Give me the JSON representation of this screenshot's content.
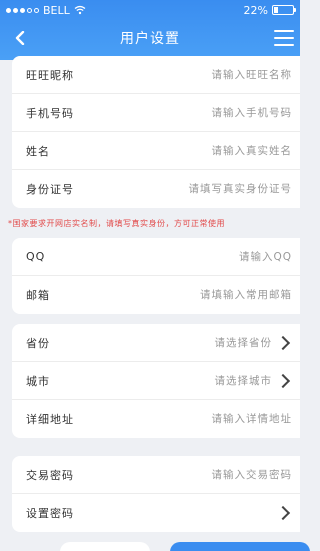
{
  "status_bar": {
    "carrier": "BELL",
    "battery": "22%",
    "battery_level": 0.22
  },
  "header": {
    "title": "用户设置"
  },
  "section1": [
    {
      "label": "旺旺昵称",
      "placeholder": "请输入旺旺名称"
    },
    {
      "label": "手机号码",
      "placeholder": "请输入手机号码"
    },
    {
      "label": "姓名",
      "placeholder": "请输入真实姓名"
    },
    {
      "label": "身份证号",
      "placeholder": "请填写真实身份证号"
    }
  ],
  "notice": "*国家要求开网店实名制，请填写真实身份，方可正常使用",
  "section2": [
    {
      "label": "QQ",
      "placeholder": "请输入QQ"
    },
    {
      "label": "邮箱",
      "placeholder": "请填输入常用邮箱"
    }
  ],
  "section3": [
    {
      "label": "省份",
      "value": "请选择省份"
    },
    {
      "label": "城市",
      "value": "请选择城市"
    },
    {
      "label": "详细地址",
      "placeholder": "请输入详情地址"
    }
  ],
  "section4": [
    {
      "label": "交易密码",
      "placeholder": "请输入交易密码"
    },
    {
      "label": "设置密码"
    }
  ],
  "colors": {
    "header": "#3a8df0",
    "notice": "#e24a4a",
    "background": "#eef0f4"
  }
}
